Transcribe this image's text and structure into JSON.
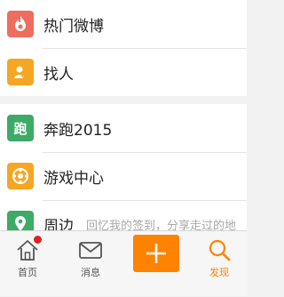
{
  "menu": {
    "group1": [
      {
        "label": "热门微博",
        "icon": "flame-icon",
        "color": "#ee6d5e"
      },
      {
        "label": "找人",
        "icon": "find-people-icon",
        "color": "#f5a623"
      }
    ],
    "group2": [
      {
        "label": "奔跑2015",
        "icon": "run-icon",
        "color": "#3daa66"
      },
      {
        "label": "游戏中心",
        "icon": "game-center-icon",
        "color": "#f5a623"
      },
      {
        "label": "周边",
        "sub": "回忆我的签到，分享走过的地",
        "icon": "location-pin-icon",
        "color": "#3daa66"
      }
    ]
  },
  "tabbar": {
    "home": {
      "label": "首页",
      "icon": "home-icon"
    },
    "messages": {
      "label": "消息",
      "icon": "mail-icon"
    },
    "compose": {
      "icon": "plus-icon",
      "color": "#ff8200"
    },
    "discover": {
      "label": "发现",
      "icon": "search-icon",
      "color": "#ff8200"
    }
  }
}
